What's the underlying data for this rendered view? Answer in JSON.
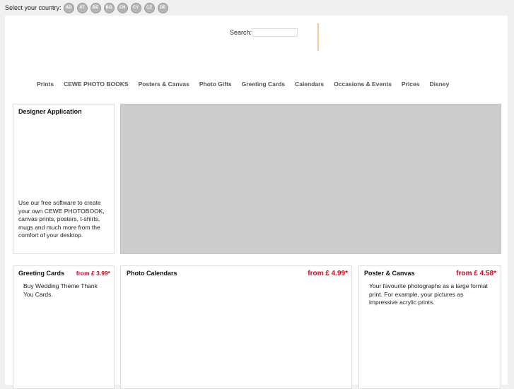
{
  "country": {
    "label": "Select your country:",
    "flags": [
      "AD",
      "AT",
      "BE",
      "BG",
      "CH",
      "CY",
      "CZ",
      "DE"
    ]
  },
  "search": {
    "label": "Search:",
    "value": "",
    "placeholder": ""
  },
  "nav": [
    "Prints",
    "CEWE PHOTO BOOKS",
    "Posters & Canvas",
    "Photo Gifts",
    "Greeting Cards",
    "Calendars",
    "Occasions & Events",
    "Prices",
    "Disney"
  ],
  "designer": {
    "title": "Designer Application",
    "text": "Use our free software to create your own CEWE PHOTOBOOK, canvas prints, posters, t-shirts, mugs and much more from the comfort of your desktop."
  },
  "cards": [
    {
      "title": "Greeting Cards",
      "price": "from £ 3.99*",
      "text": "Buy Wedding Theme Thank You Cards."
    },
    {
      "title": "Photo Calendars",
      "price": "from £ 4.99*",
      "text": ""
    },
    {
      "title": "Poster & Canvas",
      "price": "from £ 4.58*",
      "text": "Your favourite photographs as a large format print. For example, your pictures as impressive acrylic prints."
    }
  ],
  "colors": {
    "price": "#e2001a",
    "accent": "#f7c78f",
    "banner": "#cccccc"
  }
}
